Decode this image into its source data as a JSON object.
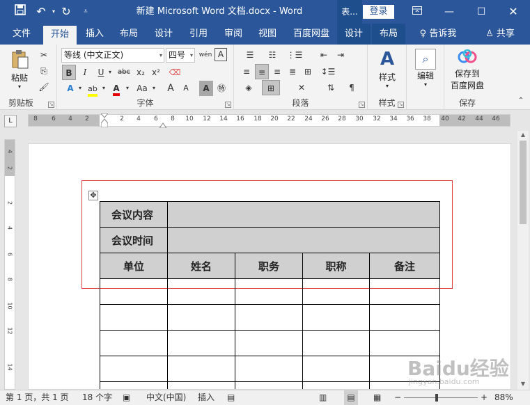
{
  "titlebar": {
    "title": "新建 Microsoft Word 文档.docx - Word",
    "context_label": "表...",
    "login_label": "登录",
    "save_icon": "save-icon",
    "undo_icon": "undo-icon",
    "redo_icon": "redo-icon"
  },
  "tabs": [
    {
      "label": "文件"
    },
    {
      "label": "开始"
    },
    {
      "label": "插入"
    },
    {
      "label": "布局"
    },
    {
      "label": "设计"
    },
    {
      "label": "引用"
    },
    {
      "label": "审阅"
    },
    {
      "label": "视图"
    },
    {
      "label": "百度网盘"
    },
    {
      "label": "设计"
    },
    {
      "label": "布局"
    }
  ],
  "tell_me": "告诉我",
  "share": "共享",
  "ribbon": {
    "clipboard": {
      "paste": "粘贴",
      "label": "剪贴板"
    },
    "font": {
      "name": "等线 (中文正文)",
      "size": "四号",
      "label": "字体",
      "bold": "B",
      "italic": "I",
      "underline": "U",
      "strike": "abc",
      "subscript": "x₂",
      "superscript": "x²",
      "grow": "A",
      "shrink": "A",
      "case": "Aa"
    },
    "paragraph": {
      "label": "段落"
    },
    "styles": {
      "btn": "样式",
      "label": "样式"
    },
    "editing": {
      "btn": "编辑"
    },
    "save": {
      "btn_line1": "保存到",
      "btn_line2": "百度网盘",
      "label": "保存"
    }
  },
  "ruler": {
    "numbers": [
      "8",
      "6",
      "4",
      "2",
      "2",
      "4",
      "6",
      "8",
      "10",
      "12",
      "14",
      "16",
      "18",
      "20",
      "22",
      "24",
      "26",
      "28",
      "30",
      "32",
      "34",
      "36",
      "38",
      "40",
      "42",
      "44",
      "46"
    ],
    "vnumbers": [
      "4",
      "2",
      "2",
      "4",
      "6",
      "8",
      "10",
      "12",
      "14"
    ]
  },
  "table": {
    "rows": [
      {
        "label": "会议内容"
      },
      {
        "label": "会议时间"
      }
    ],
    "headers": [
      "单位",
      "姓名",
      "职务",
      "职称",
      "备注"
    ]
  },
  "statusbar": {
    "page": "第 1 页，共 1 页",
    "words": "18 个字",
    "language": "中文(中国)",
    "mode": "插入",
    "zoom": "88%"
  },
  "watermark": {
    "brand": "Baidu经验",
    "sub": "jingyan.baidu.com"
  },
  "colors": {
    "brand": "#2b579a",
    "highlight": "#ffff00",
    "font_color": "#e00000",
    "selection_box": "#e04040"
  }
}
